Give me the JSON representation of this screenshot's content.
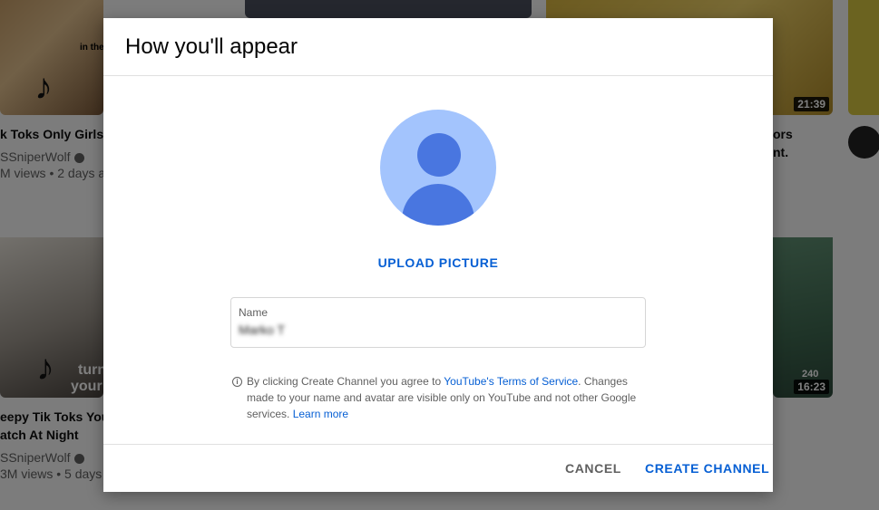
{
  "dialog": {
    "title": "How you'll appear",
    "upload_label": "UPLOAD PICTURE",
    "name_label": "Name",
    "name_value": "Marko T",
    "terms": {
      "prefix": "By clicking Create Channel you agree to ",
      "tos_link": "YouTube's Terms of Service",
      "middle": ". Changes made to your name and avatar are visible only on YouTube and not other Google services. ",
      "learn_more": "Learn more"
    },
    "cancel_label": "CANCEL",
    "create_label": "CREATE CHANNEL"
  },
  "feed": {
    "video1": {
      "title": "k Toks Only Girls U",
      "channel": "SSniperWolf",
      "meta": "M views • 2 days a"
    },
    "video2": {
      "title_line1": "ors",
      "title_line2": "nt.",
      "duration": "21:39"
    },
    "video3": {
      "title_line1": "eepy Tik Toks You",
      "title_line2": "atch At Night",
      "channel": "SSniperWolf",
      "meta": "3M views • 5 days"
    },
    "video4": {
      "duration": "16:23",
      "badge": "240"
    },
    "thumb_text1": "in the",
    "thumb_text2": "turn",
    "thumb_text3": "your"
  },
  "colors": {
    "accent": "#065fd4",
    "avatar_bg": "#a3c4fd",
    "avatar_fg": "#4976e0"
  }
}
